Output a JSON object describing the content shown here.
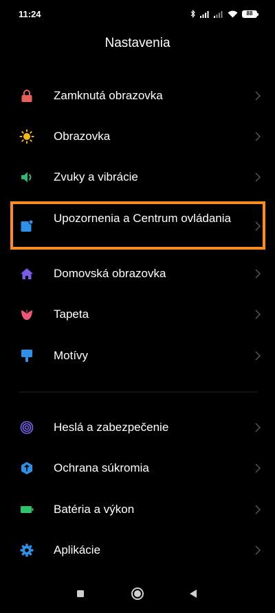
{
  "status_bar": {
    "time": "11:24",
    "battery_level": "88"
  },
  "page": {
    "title": "Nastavenia"
  },
  "menu": {
    "items": [
      {
        "label": "Zamknutá obrazovka",
        "icon": "lock-icon",
        "color": "#e5605a"
      },
      {
        "label": "Obrazovka",
        "icon": "sun-icon",
        "color": "#f5b81b"
      },
      {
        "label": "Zvuky a vibrácie",
        "icon": "speaker-icon",
        "color": "#2fb874"
      },
      {
        "label": "Upozornenia a Centrum ovládania",
        "icon": "notification-icon",
        "color": "#2e90e6"
      },
      {
        "label": "Domovská obrazovka",
        "icon": "home-icon",
        "color": "#7a5ce8"
      },
      {
        "label": "Tapeta",
        "icon": "tulip-icon",
        "color": "#ec5776"
      },
      {
        "label": "Motívy",
        "icon": "paintbrush-icon",
        "color": "#2e90e6"
      },
      {
        "label": "Heslá a zabezpečenie",
        "icon": "fingerprint-icon",
        "color": "#7a64f0"
      },
      {
        "label": "Ochrana súkromia",
        "icon": "privacy-shield-icon",
        "color": "#2e90e6"
      },
      {
        "label": "Batéria a výkon",
        "icon": "battery-icon",
        "color": "#2fc46a"
      },
      {
        "label": "Aplikácie",
        "icon": "gear-icon",
        "color": "#2e90e6"
      }
    ]
  },
  "colors": {
    "highlight": "#ff8a1f",
    "chevron": "#555555"
  }
}
